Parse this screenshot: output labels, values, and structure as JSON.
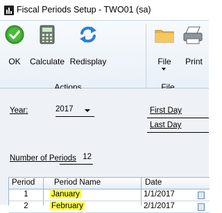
{
  "window": {
    "title": "Fiscal Periods Setup  -  TWO01 (sa)"
  },
  "ribbon": {
    "buttons": [
      {
        "label": "OK",
        "icon": "ok-check-icon"
      },
      {
        "label": "Calculate",
        "icon": "calculator-icon"
      },
      {
        "label": "Redisplay",
        "icon": "redisplay-arrows-icon"
      },
      {
        "label": "File",
        "icon": "folder-icon"
      },
      {
        "label": "Print",
        "icon": "printer-icon"
      }
    ],
    "groups": [
      {
        "label": "Actions"
      },
      {
        "label": "File"
      }
    ]
  },
  "form": {
    "year_label": "Year:",
    "year_value": "2017",
    "first_day_label": "First Day",
    "last_day_label": "Last Day",
    "number_of_periods_label": "Number of Periods",
    "number_of_periods_value": "12"
  },
  "grid": {
    "columns": [
      "Period",
      "Period Name",
      "Date"
    ],
    "rows": [
      {
        "period": "1",
        "name": "January",
        "date": "1/1/2017"
      },
      {
        "period": "2",
        "name": "February",
        "date": "2/1/2017"
      }
    ]
  },
  "colors": {
    "highlight": "#ffff44",
    "ok_green": "#3aa12f",
    "redisplay_blue": "#2a7fd4"
  }
}
